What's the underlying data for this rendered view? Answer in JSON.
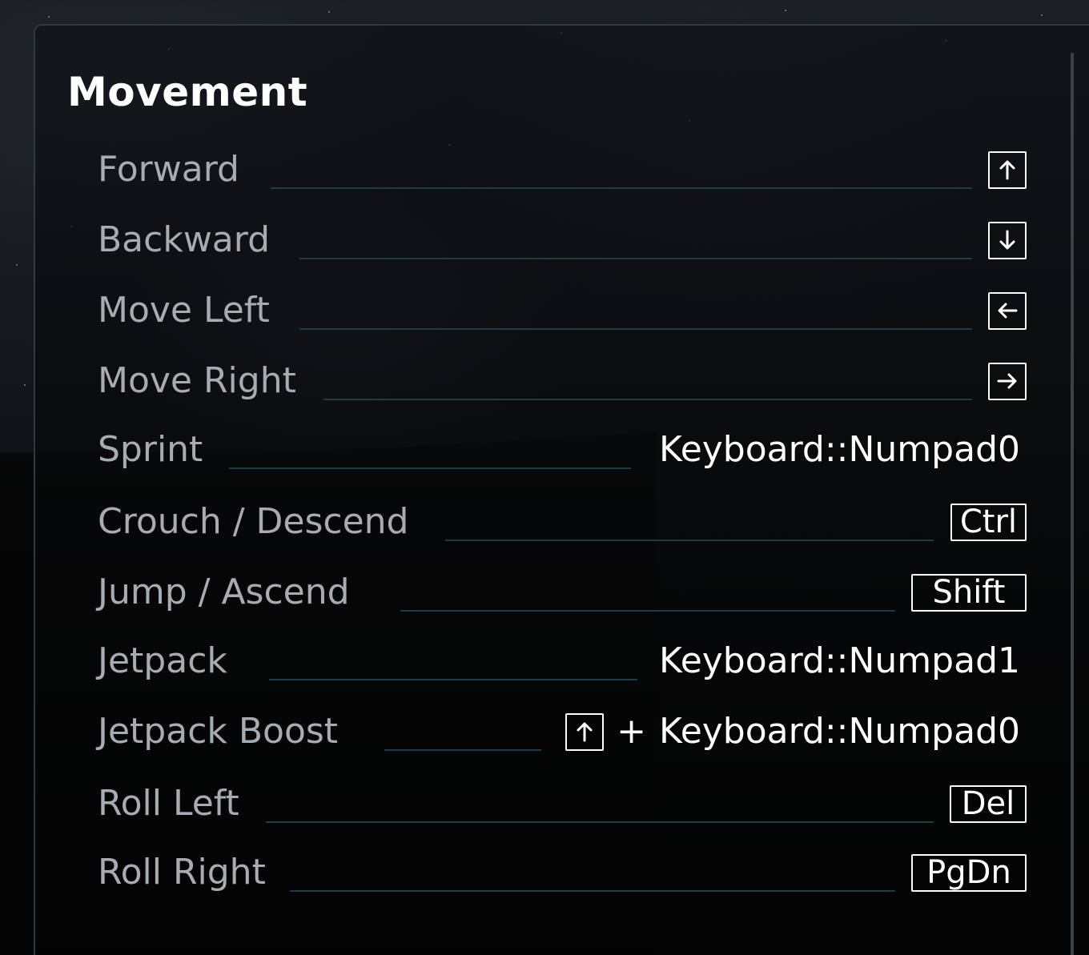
{
  "section": {
    "title": "Movement"
  },
  "bindings": [
    {
      "label": "Forward",
      "keys": [
        {
          "icon": "arrow-up-icon"
        }
      ]
    },
    {
      "label": "Backward",
      "keys": [
        {
          "icon": "arrow-down-icon"
        }
      ]
    },
    {
      "label": "Move Left",
      "keys": [
        {
          "icon": "arrow-left-icon"
        }
      ]
    },
    {
      "label": "Move Right",
      "keys": [
        {
          "icon": "arrow-right-icon"
        }
      ]
    },
    {
      "label": "Sprint",
      "plain": "Keyboard::Numpad0"
    },
    {
      "label": "Crouch / Descend",
      "keys": [
        {
          "text": "Ctrl"
        }
      ]
    },
    {
      "label": "Jump / Ascend",
      "keys": [
        {
          "text": "Shift"
        }
      ]
    },
    {
      "label": "Jetpack",
      "plain": "Keyboard::Numpad1"
    },
    {
      "label": "Jetpack Boost",
      "combo": {
        "modifier_icon": "arrow-up-icon",
        "separator": "+",
        "plain": "Keyboard::Numpad0"
      }
    },
    {
      "label": "Roll Left",
      "keys": [
        {
          "text": "Del"
        }
      ]
    },
    {
      "label": "Roll Right",
      "keys": [
        {
          "text": "PgDn"
        }
      ]
    }
  ],
  "colors": {
    "label": "#a7acb0",
    "binding": "#ffffff",
    "leader": "#1c3d46",
    "panel_border": "#2e3a3f"
  }
}
